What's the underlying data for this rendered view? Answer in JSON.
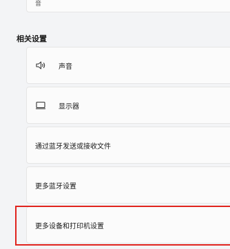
{
  "top_card_text": "音",
  "section_title": "相关设置",
  "rows": [
    {
      "label": "声音",
      "icon": "speaker-icon"
    },
    {
      "label": "显示器",
      "icon": "monitor-icon"
    },
    {
      "label": "通过蓝牙发送或接收文件"
    },
    {
      "label": "更多蓝牙设置"
    },
    {
      "label": "更多设备和打印机设置"
    }
  ],
  "highlight_color": "#e0231d"
}
